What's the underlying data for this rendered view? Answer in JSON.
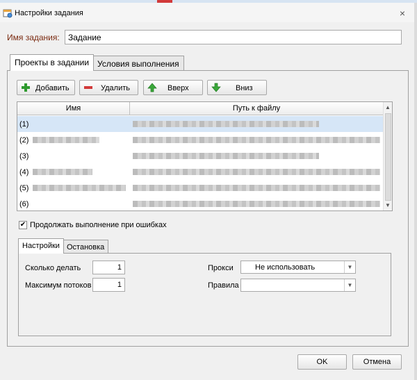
{
  "window": {
    "title": "Настройки задания",
    "close_symbol": "×"
  },
  "task_name": {
    "label": "Имя задания:",
    "value": "Задание"
  },
  "main_tabs": [
    {
      "label": "Проекты в задании",
      "active": true
    },
    {
      "label": "Условия выполнения",
      "active": false
    }
  ],
  "toolbar": {
    "add_label": "Добавить",
    "delete_label": "Удалить",
    "up_label": "Вверх",
    "down_label": "Вниз"
  },
  "grid": {
    "columns": [
      "Имя",
      "Путь к файлу"
    ],
    "rows": [
      {
        "num": "(1)",
        "selected": true
      },
      {
        "num": "(2)",
        "selected": false
      },
      {
        "num": "(3)",
        "selected": false
      },
      {
        "num": "(4)",
        "selected": false
      },
      {
        "num": "(5)",
        "selected": false
      },
      {
        "num": "(6)",
        "selected": false
      }
    ]
  },
  "continue_on_errors": {
    "label": "Продолжать выполнение при ошибках",
    "checked": true
  },
  "sub_tabs": [
    {
      "label": "Настройки",
      "active": true
    },
    {
      "label": "Остановка",
      "active": false
    }
  ],
  "settings": {
    "how_many_label": "Сколько делать",
    "how_many_value": "1",
    "max_threads_label": "Максимум потоков",
    "max_threads_value": "1",
    "proxy_label": "Прокси",
    "proxy_value": "Не использовать",
    "rules_label": "Правила",
    "rules_value": ""
  },
  "footer": {
    "ok_label": "OK",
    "cancel_label": "Отмена"
  },
  "colors": {
    "selected_row": "#d6e6f7",
    "label_accent": "#7a2a10",
    "add_icon": "#2f9a2f",
    "delete_icon": "#d23a3a"
  }
}
